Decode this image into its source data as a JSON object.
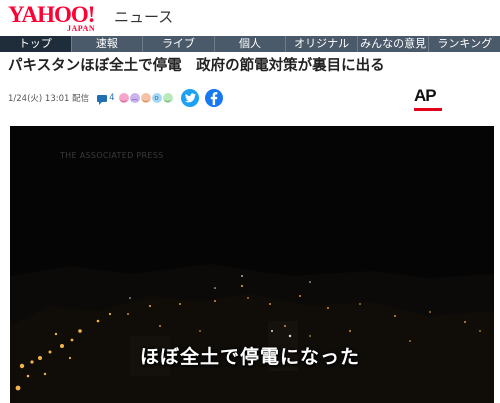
{
  "header": {
    "logo_main": "YAHOO!",
    "logo_sub": "JAPAN",
    "service": "ニュース"
  },
  "nav": {
    "items": [
      "トップ",
      "速報",
      "ライブ",
      "個人",
      "オリジナル",
      "みんなの意見",
      "ランキング"
    ],
    "active_index": 0
  },
  "article": {
    "title": "パキスタンほぼ全土で停電　政府の節電対策が裏目に出る",
    "date": "1/24(火) 13:01 配信",
    "comment_count": "4",
    "reaction_icons": [
      "smile-reaction-icon",
      "sad-reaction-icon",
      "angry-reaction-icon",
      "surprise-reaction-icon",
      "happy-reaction-icon"
    ],
    "source_logo": "AP"
  },
  "video": {
    "watermark": "THE ASSOCIATED PRESS",
    "subtitle": "ほぼ全土で停電になった"
  },
  "colors": {
    "brand": "#ff0033",
    "nav_bg": "#4a5a6a",
    "nav_active": "#1f2d3a",
    "twitter": "#1da1f2",
    "facebook": "#1877f2",
    "ap_red": "#e3001b"
  }
}
